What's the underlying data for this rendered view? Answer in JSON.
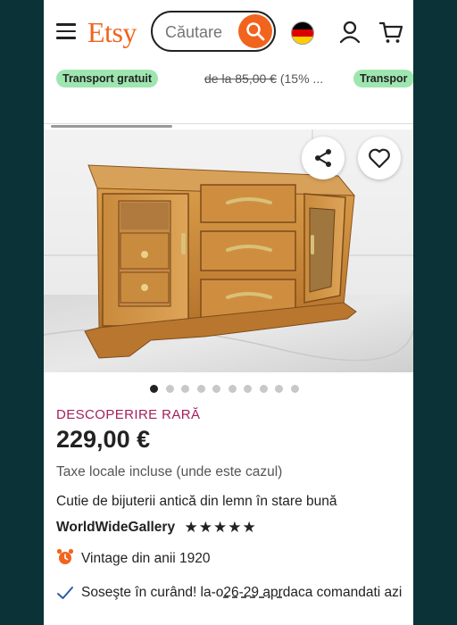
{
  "header": {
    "logo": "Etsy",
    "search_placeholder": "Căutare",
    "flag_colors": [
      "#000000",
      "#dd0000",
      "#ffce00"
    ]
  },
  "strip": {
    "badge_left": "Transport gratuit",
    "price_prefix": "de la",
    "original_price": "85,00 €",
    "discount": "(15% ...",
    "badge_right": "Transpor"
  },
  "carousel": {
    "count": 10,
    "active_index": 0
  },
  "product": {
    "rare_label": "DESCOPERIRE RARĂ",
    "price": "229,00 €",
    "tax_note": "Taxe locale incluse (unde este cazul)",
    "title": "Cutie de bijuterii antică din lemn în stare bună",
    "shop_name": "WorldWideGallery",
    "rating_stars": 5,
    "vintage": "Vintage din anii 1920",
    "delivery_prefix": "Soseşte în curând! la-o",
    "delivery_dates": "26-29 apr",
    "delivery_suffix": "daca comandati azi"
  },
  "colors": {
    "accent": "#f1641e",
    "rare": "#a3205e",
    "badge_bg": "#9ee6b0",
    "background": "#0b3236"
  }
}
